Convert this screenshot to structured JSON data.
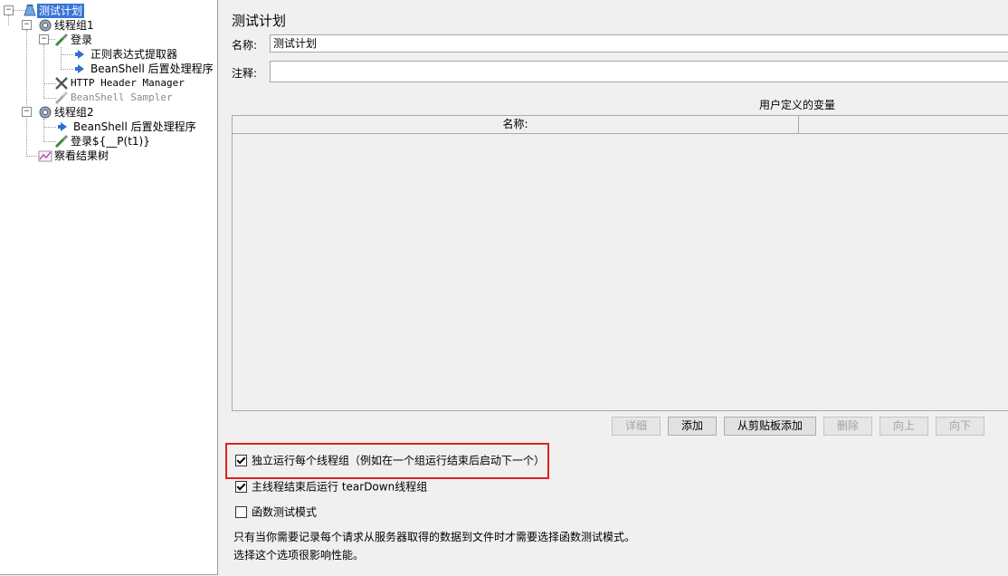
{
  "tree": {
    "root": "测试计划",
    "thread_group_1": "线程组1",
    "login": "登录",
    "regex_extractor": "正则表达式提取器",
    "beanshell_post_1": "BeanShell 后置处理程序",
    "http_header_manager": "HTTP Header Manager",
    "beanshell_sampler": "BeanShell Sampler",
    "thread_group_2": "线程组2",
    "beanshell_post_2": "BeanShell 后置处理程序",
    "login_p": "登录${__P(t1)}",
    "view_results_tree": "察看结果树"
  },
  "panel": {
    "title": "测试计划",
    "name_label": "名称:",
    "name_value": "测试计划",
    "comment_label": "注释:",
    "comment_value": "",
    "vars_title": "用户定义的变量",
    "vars_col_name": "名称:",
    "vars_col_value": ""
  },
  "buttons": {
    "detail": "详细",
    "add": "添加",
    "add_from_clipboard": "从剪贴板添加",
    "delete": "删除",
    "up": "向上",
    "down": "向下"
  },
  "options": {
    "run_groups_consecutively": {
      "label": "独立运行每个线程组（例如在一个组运行结束后启动下一个）",
      "checked": true
    },
    "teardown_after_shutdown": {
      "label": "主线程结束后运行 tearDown线程组",
      "checked": true
    },
    "functional_test_mode": {
      "label": "函数测试模式",
      "checked": false
    }
  },
  "notes": {
    "line1": "只有当你需要记录每个请求从服务器取得的数据到文件时才需要选择函数测试模式。",
    "line2": "选择这个选项很影响性能。"
  },
  "colors": {
    "selection": "#3875d7",
    "highlight_border": "#e02020"
  }
}
